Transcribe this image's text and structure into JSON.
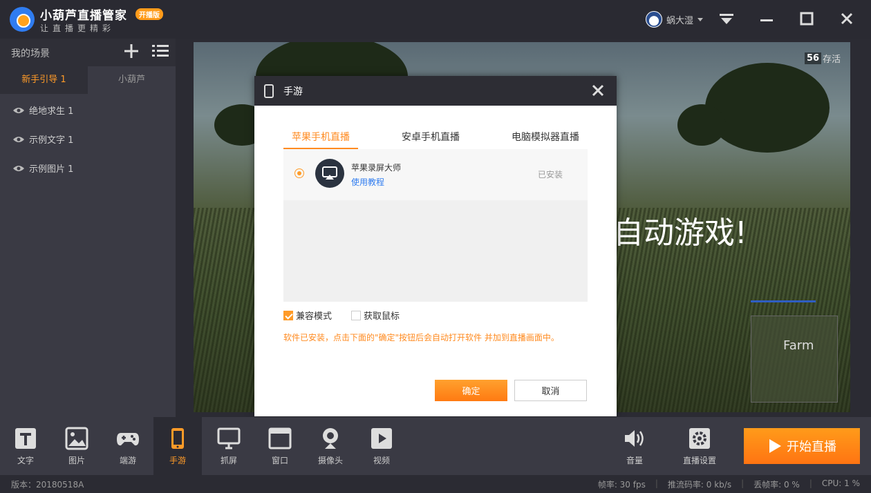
{
  "app": {
    "title": "小葫芦直播管家",
    "badge": "开播版",
    "slogan": "让直播更精彩",
    "username": "蜗大湿"
  },
  "sidebar": {
    "scene_title": "我的场景",
    "tabs": [
      "新手引导 1",
      "小葫芦"
    ],
    "sources": [
      "绝地求生 1",
      "示例文字 1",
      "示例图片 1"
    ]
  },
  "preview": {
    "overlay_text": "自动游戏!",
    "alive_count": "56",
    "alive_label": "存活",
    "minimap_label": "Farm"
  },
  "modal": {
    "title": "手游",
    "tabs": [
      "苹果手机直播",
      "安卓手机直播",
      "电脑模拟器直播"
    ],
    "app_name": "苹果录屏大师",
    "app_link": "使用教程",
    "app_status": "已安装",
    "check_compat": "兼容模式",
    "check_mouse": "获取鼠标",
    "hint": "软件已安装，点击下面的\"确定\"按钮后会自动打开软件 并加到直播画面中。",
    "ok": "确定",
    "cancel": "取消"
  },
  "toolbar": {
    "items": [
      "文字",
      "图片",
      "端游",
      "手游",
      "抓屏",
      "窗口",
      "摄像头",
      "视频"
    ],
    "volume": "音量",
    "live_settings": "直播设置",
    "start": "开始直播"
  },
  "status": {
    "version": "版本：20180518A",
    "fps": "帧率: 30 fps",
    "bitrate": "推流码率: 0 kb/s",
    "drop": "丢帧率: 0 %",
    "cpu": "CPU: 1 %"
  },
  "colors": {
    "accent": "#ff9b28",
    "link": "#2f7cf0",
    "dark": "#2b2b33"
  }
}
